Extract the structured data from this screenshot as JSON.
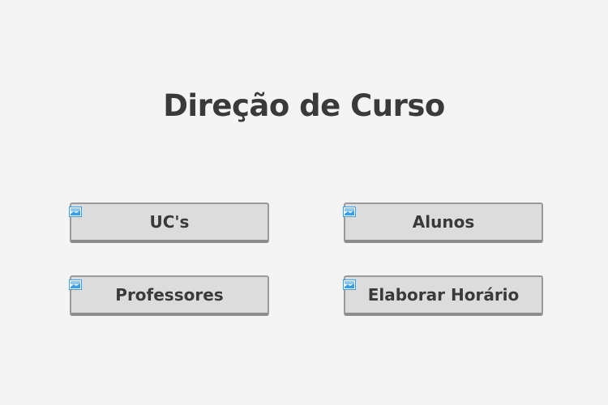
{
  "page": {
    "title": "Direção de Curso"
  },
  "buttons": {
    "ucs": {
      "label": "UC's",
      "icon": "broken-image-icon"
    },
    "alunos": {
      "label": "Alunos",
      "icon": "broken-image-icon"
    },
    "professores": {
      "label": "Professores",
      "icon": "broken-image-icon"
    },
    "horario": {
      "label": "Elaborar Horário",
      "icon": "broken-image-icon"
    }
  },
  "colors": {
    "background": "#f4f4f4",
    "button_fill": "#dcdcdc",
    "button_border": "#9a9a9a",
    "text": "#3a3a3a",
    "icon_accent": "#3c9ee5"
  }
}
